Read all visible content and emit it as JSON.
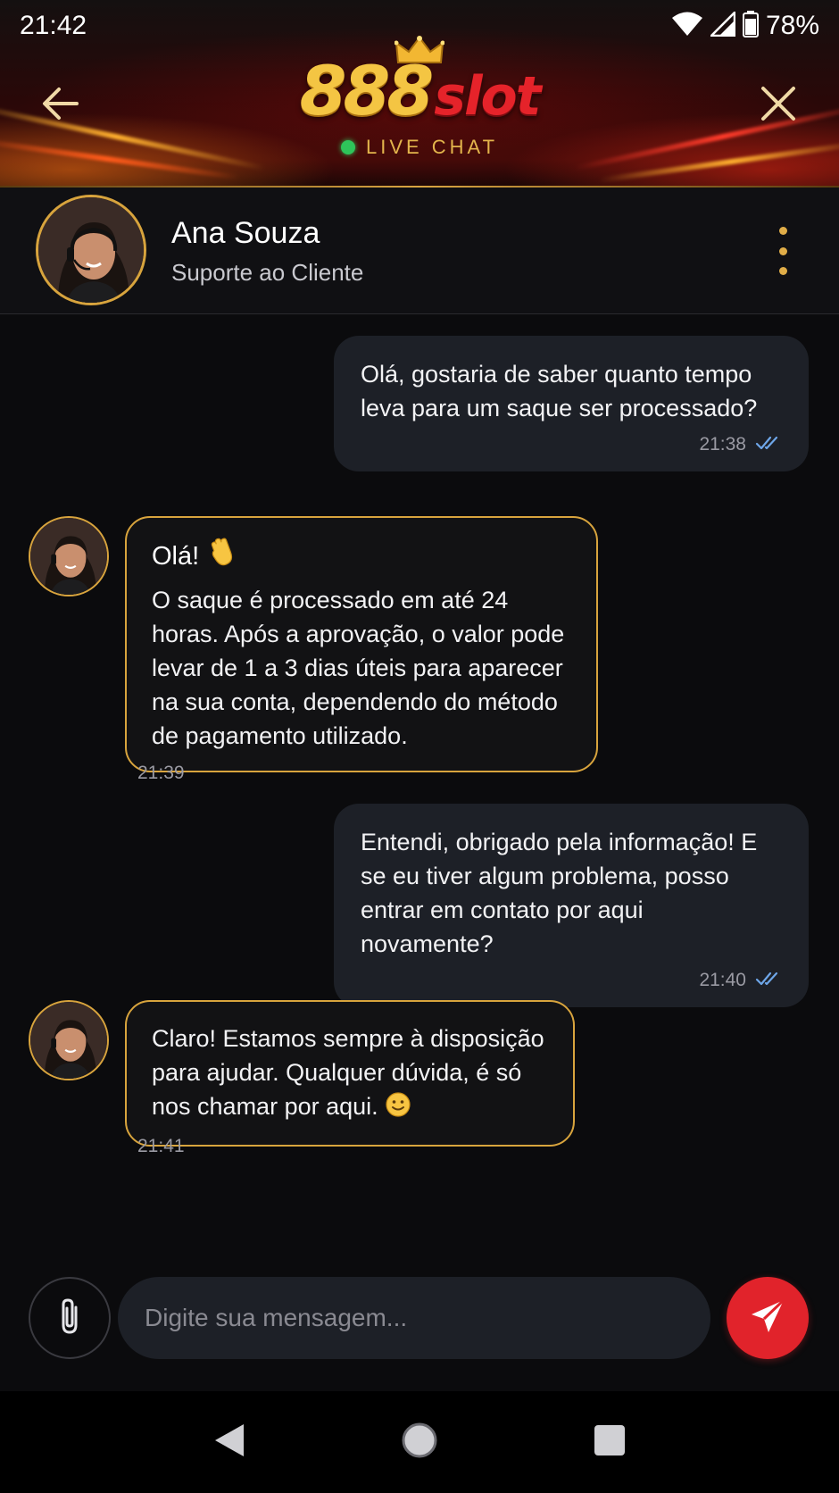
{
  "status_bar": {
    "time": "21:42",
    "battery": "78%",
    "icons": [
      "wifi-icon",
      "signal-icon",
      "battery-icon"
    ]
  },
  "header": {
    "logo_number": "888",
    "logo_word": "slot",
    "live_label": "LIVE CHAT",
    "back_icon": "arrow-left-icon",
    "close_icon": "close-icon",
    "colors": {
      "gold": "#f4c543",
      "red": "#e5232a",
      "live_dot": "#2ec45a"
    }
  },
  "agent": {
    "name": "Ana Souza",
    "role": "Suporte ao Cliente",
    "menu_icon": "more-vertical-icon"
  },
  "messages": [
    {
      "direction": "outgoing",
      "text": "Olá, gostaria de saber quanto tempo leva para um saque ser processado?",
      "time": "21:38",
      "read_icon": "double-check-icon"
    },
    {
      "direction": "incoming",
      "greeting": "Olá!",
      "greeting_emoji": "waving-hand-emoji",
      "text": "O saque é processado em até 24 horas. Após a aprovação, o valor pode levar de 1 a 3 dias úteis para aparecer na sua conta, dependendo do método de pagamento utilizado.",
      "time": "21:39"
    },
    {
      "direction": "outgoing",
      "text": "Entendi, obrigado pela informação! E se eu tiver algum problema, posso entrar em contato por aqui novamente?",
      "time": "21:40",
      "read_icon": "double-check-icon"
    },
    {
      "direction": "incoming",
      "text": "Claro! Estamos sempre à disposição para ajudar. Qualquer dúvida, é só nos chamar por aqui.",
      "emoji": "smiling-face-emoji",
      "time": "21:41"
    }
  ],
  "composer": {
    "placeholder": "Digite sua mensagem...",
    "value": "",
    "attach_icon": "paperclip-icon",
    "send_icon": "send-icon",
    "send_color": "#e1232b"
  },
  "navigation": {
    "icons": [
      "nav-back-icon",
      "nav-home-icon",
      "nav-recents-icon"
    ]
  }
}
